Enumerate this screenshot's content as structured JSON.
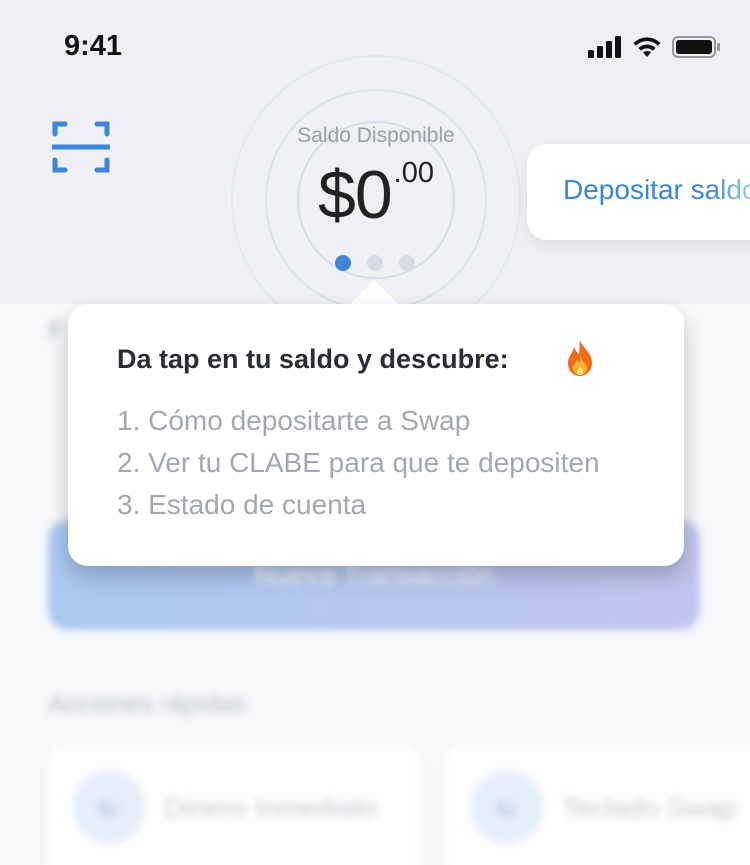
{
  "status_bar": {
    "time": "9:41",
    "icons": [
      "cellular-signal-icon",
      "wifi-icon",
      "battery-icon"
    ]
  },
  "header": {
    "scan_icon": "scan-qr-icon",
    "balance_label": "Saldo Disponible",
    "balance_main": "$0",
    "balance_cents": ".00",
    "carousel_pages": 3,
    "carousel_active": 0,
    "deposit_card_label": "Depositar saldo"
  },
  "background": {
    "new_transaction_label": "Nueva Transacción",
    "quick_actions_title": "Acciones rápidas",
    "quick_actions": [
      {
        "label": "Dinero Inmediato",
        "icon": "swap-icon"
      },
      {
        "label": "Teclado Swap",
        "icon": "swap-icon"
      }
    ]
  },
  "tooltip": {
    "title": "Da tap en tu saldo y descubre:",
    "emoji": "fire-icon",
    "items": [
      "1. Cómo depositarte a Swap",
      "2. Ver tu CLABE para que te depositen",
      "3. Estado de cuenta"
    ]
  },
  "colors": {
    "accent": "#3d86d9",
    "header_bg": "#eef0f3",
    "tooltip_bg": "#ffffff",
    "muted_text": "#a3a8b0"
  }
}
